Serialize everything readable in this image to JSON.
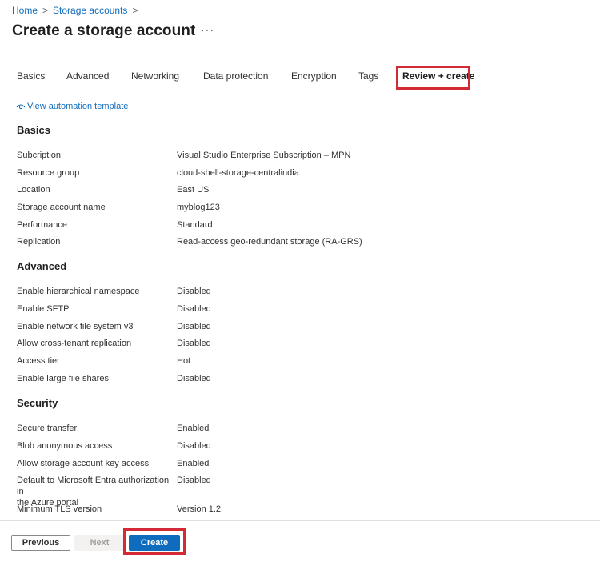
{
  "breadcrumb": {
    "items": [
      "Home",
      "Storage accounts"
    ],
    "separator": ">"
  },
  "page": {
    "title": "Create a storage account",
    "more_label": "···"
  },
  "tabs": [
    {
      "label": "Basics",
      "active": false
    },
    {
      "label": "Advanced",
      "active": false
    },
    {
      "label": "Networking",
      "active": false
    },
    {
      "label": "Data protection",
      "active": false
    },
    {
      "label": "Encryption",
      "active": false
    },
    {
      "label": "Tags",
      "active": false
    },
    {
      "label": "Review + create",
      "active": true
    }
  ],
  "automation_link": {
    "label": "View automation template",
    "icon": "eye-icon"
  },
  "sections": {
    "basics": {
      "heading": "Basics",
      "rows": [
        {
          "label": "Subcription",
          "value": "Visual Studio Enterprise Subscription – MPN"
        },
        {
          "label": "Resource group",
          "value": "cloud-shell-storage-centralindia"
        },
        {
          "label": "Location",
          "value": "East US"
        },
        {
          "label": "Storage account name",
          "value": "myblog123"
        },
        {
          "label": "Performance",
          "value": "Standard"
        },
        {
          "label": "Replication",
          "value": "Read-access geo-redundant storage (RA-GRS)"
        }
      ]
    },
    "advanced": {
      "heading": "Advanced",
      "rows": [
        {
          "label": "Enable hierarchical namespace",
          "value": "Disabled"
        },
        {
          "label": "Enable SFTP",
          "value": "Disabled"
        },
        {
          "label": "Enable network file system v3",
          "value": "Disabled"
        },
        {
          "label": "Allow cross-tenant replication",
          "value": "Disabled"
        },
        {
          "label": "Access tier",
          "value": "Hot"
        },
        {
          "label": "Enable large file shares",
          "value": "Disabled"
        }
      ]
    },
    "security": {
      "heading": "Security",
      "rows": [
        {
          "label": "Secure transfer",
          "value": "Enabled"
        },
        {
          "label": "Blob anonymous access",
          "value": "Disabled"
        },
        {
          "label": "Allow storage account key access",
          "value": "Enabled"
        },
        {
          "label": "Default to Microsoft Entra authorization in\nthe Azure portal",
          "value": "Disabled"
        },
        {
          "label": "Minimum TLS version",
          "value": "Version 1.2"
        }
      ]
    }
  },
  "footer": {
    "previous_label": "Previous",
    "next_label": "Next",
    "create_label": "Create"
  },
  "colors": {
    "accent": "#0f6cbd",
    "highlight_box": "#d32b36"
  }
}
